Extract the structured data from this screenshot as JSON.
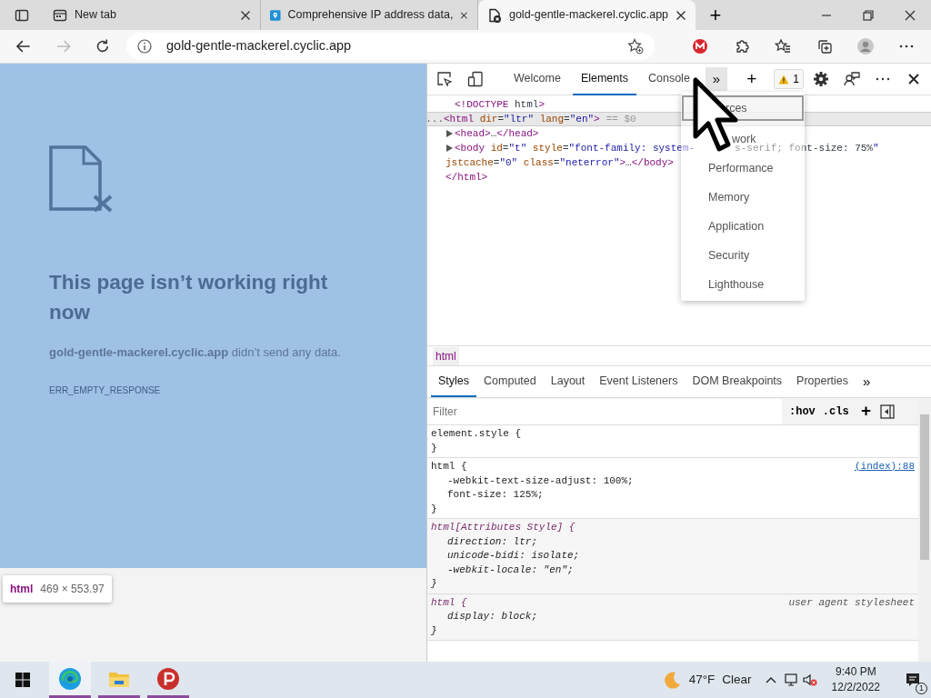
{
  "browser_tabs": [
    {
      "title": "New tab",
      "selected": false
    },
    {
      "title": "Comprehensive IP address data,",
      "selected": false
    },
    {
      "title": "gold-gentle-mackerel.cyclic.app",
      "selected": true
    }
  ],
  "new_tab_button": "+",
  "address_bar": {
    "url": "gold-gentle-mackerel.cyclic.app"
  },
  "error_page": {
    "title": "This page isn’t working right now",
    "message": "**gold-gentle-mackerel.cyclic.app** didn’t send any data.",
    "code": "ERR_EMPTY_RESPONSE"
  },
  "element_tooltip": {
    "tag": "html",
    "size": "469 × 553.97"
  },
  "devtools": {
    "tabs": [
      {
        "label": "Welcome",
        "selected": false
      },
      {
        "label": "Elements",
        "selected": true
      },
      {
        "label": "Console",
        "selected": false
      }
    ],
    "more_tabs": "»",
    "add_tab": "+",
    "warning_count": "1",
    "dom_lines": [
      {
        "segments": [
          "<!DOCTYPE html>"
        ],
        "expander": false,
        "indent": true,
        "selected": false
      },
      {
        "gutter": "...",
        "segments": [
          "<html dir=\"ltr\" lang=\"en\">"
        ],
        "suffix": "== $0",
        "expander": false,
        "selected": true
      },
      {
        "segments": [
          "<head>…</head>"
        ],
        "expander": true,
        "indent": true,
        "selected": false
      },
      {
        "segments": [
          "<body id=\"t\" style=\"font-family: system-",
          "s-serif; font-size: 75%\""
        ],
        "expander": true,
        "indent": true,
        "selected": false
      },
      {
        "segments": [
          "jstcache=\"0\" class=\"neterror\">…</body>"
        ],
        "expander": false,
        "indent": false,
        "selected": false
      },
      {
        "segments": [
          "</html>"
        ],
        "expander": false,
        "indent": false,
        "selected": false
      }
    ],
    "more_menu": [
      {
        "label": "rces",
        "selected": true
      },
      {
        "label": "work",
        "selected": false
      },
      {
        "label": "Performance",
        "selected": false
      },
      {
        "label": "Memory",
        "selected": false
      },
      {
        "label": "Application",
        "selected": false
      },
      {
        "label": "Security",
        "selected": false
      },
      {
        "label": "Lighthouse",
        "selected": false
      }
    ],
    "breadcrumb": "html",
    "pane_tabs": [
      {
        "label": "Styles",
        "selected": true
      },
      {
        "label": "Computed",
        "selected": false
      },
      {
        "label": "Layout",
        "selected": false
      },
      {
        "label": "Event Listeners",
        "selected": false
      },
      {
        "label": "DOM Breakpoints",
        "selected": false
      },
      {
        "label": "Properties",
        "selected": false
      }
    ],
    "pane_more": "»",
    "filter": {
      "placeholder": "Filter"
    },
    "hov": ":hov",
    "cls": ".cls",
    "add_rule": "+",
    "rules": [
      {
        "kind": "inline",
        "selector": "element.style {",
        "close": "}"
      },
      {
        "kind": "author",
        "selector": "html {",
        "source": "(index):88",
        "props": [
          "-webkit-text-size-adjust: 100%;",
          "font-size: 125%;"
        ],
        "close": "}"
      },
      {
        "kind": "attributes",
        "selector": "html[Attributes Style] {",
        "props": [
          "direction: ltr;",
          "unicode-bidi: isolate;",
          "-webkit-locale: \"en\";"
        ],
        "close": "}"
      },
      {
        "kind": "user_agent",
        "selector": "html {",
        "source": "user agent stylesheet",
        "props": [
          "display: block;"
        ],
        "close": "}"
      }
    ]
  },
  "taskbar": {
    "apps": [
      {
        "selected": true
      },
      {
        "selected": false
      },
      {
        "selected": false
      }
    ],
    "temperature": "47°F",
    "weather": "Clear",
    "time": "9:40 PM",
    "date": "12/2/2022",
    "notification_count": "1"
  }
}
